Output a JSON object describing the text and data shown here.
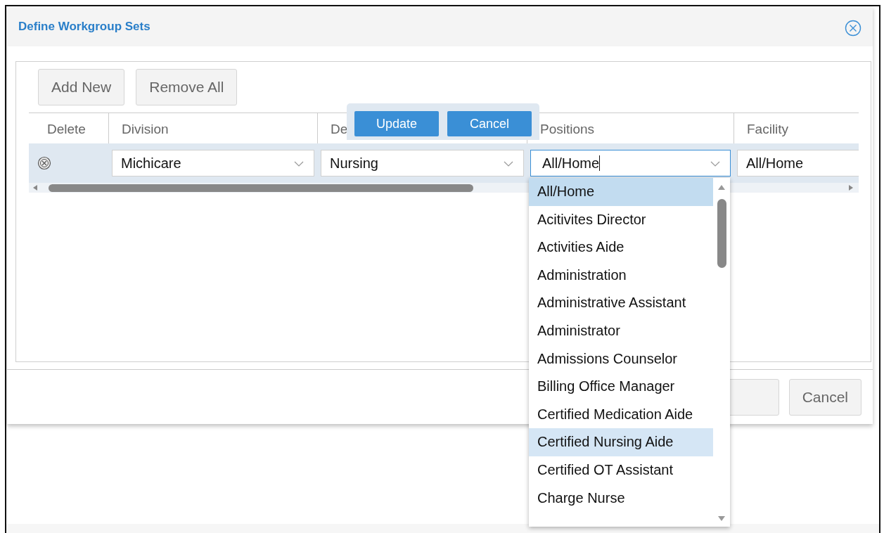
{
  "dialog": {
    "title": "Define Workgroup Sets",
    "toolbar_buttons": [
      "Add New",
      "Remove All"
    ],
    "table": {
      "columns": [
        "Delete",
        "Division",
        "De",
        "Positions",
        "Facility"
      ],
      "rows": [
        {
          "division": "Michicare",
          "department": "Nursing",
          "positions": "All/Home",
          "facility": "All/Home",
          "editing": true
        }
      ]
    },
    "row_editor": {
      "buttons": [
        "Update",
        "Cancel"
      ]
    },
    "footer": {
      "cancel": "Cancel"
    }
  },
  "positions_dropdown": {
    "items": [
      {
        "label": "All/Home",
        "selected": true,
        "highlighted": false
      },
      {
        "label": "Acitivites Director",
        "selected": false,
        "highlighted": false
      },
      {
        "label": "Activities Aide",
        "selected": false,
        "highlighted": false
      },
      {
        "label": "Administration",
        "selected": false,
        "highlighted": false
      },
      {
        "label": "Administrative Assistant",
        "selected": false,
        "highlighted": false
      },
      {
        "label": "Administrator",
        "selected": false,
        "highlighted": false
      },
      {
        "label": "Admissions Counselor",
        "selected": false,
        "highlighted": false
      },
      {
        "label": "Billing Office Manager",
        "selected": false,
        "highlighted": false
      },
      {
        "label": "Certified Medication Aide",
        "selected": false,
        "highlighted": false
      },
      {
        "label": "Certified Nursing Aide",
        "selected": false,
        "highlighted": true
      },
      {
        "label": "Certified OT Assistant",
        "selected": false,
        "highlighted": false
      },
      {
        "label": "Charge Nurse",
        "selected": false,
        "highlighted": false
      }
    ]
  }
}
